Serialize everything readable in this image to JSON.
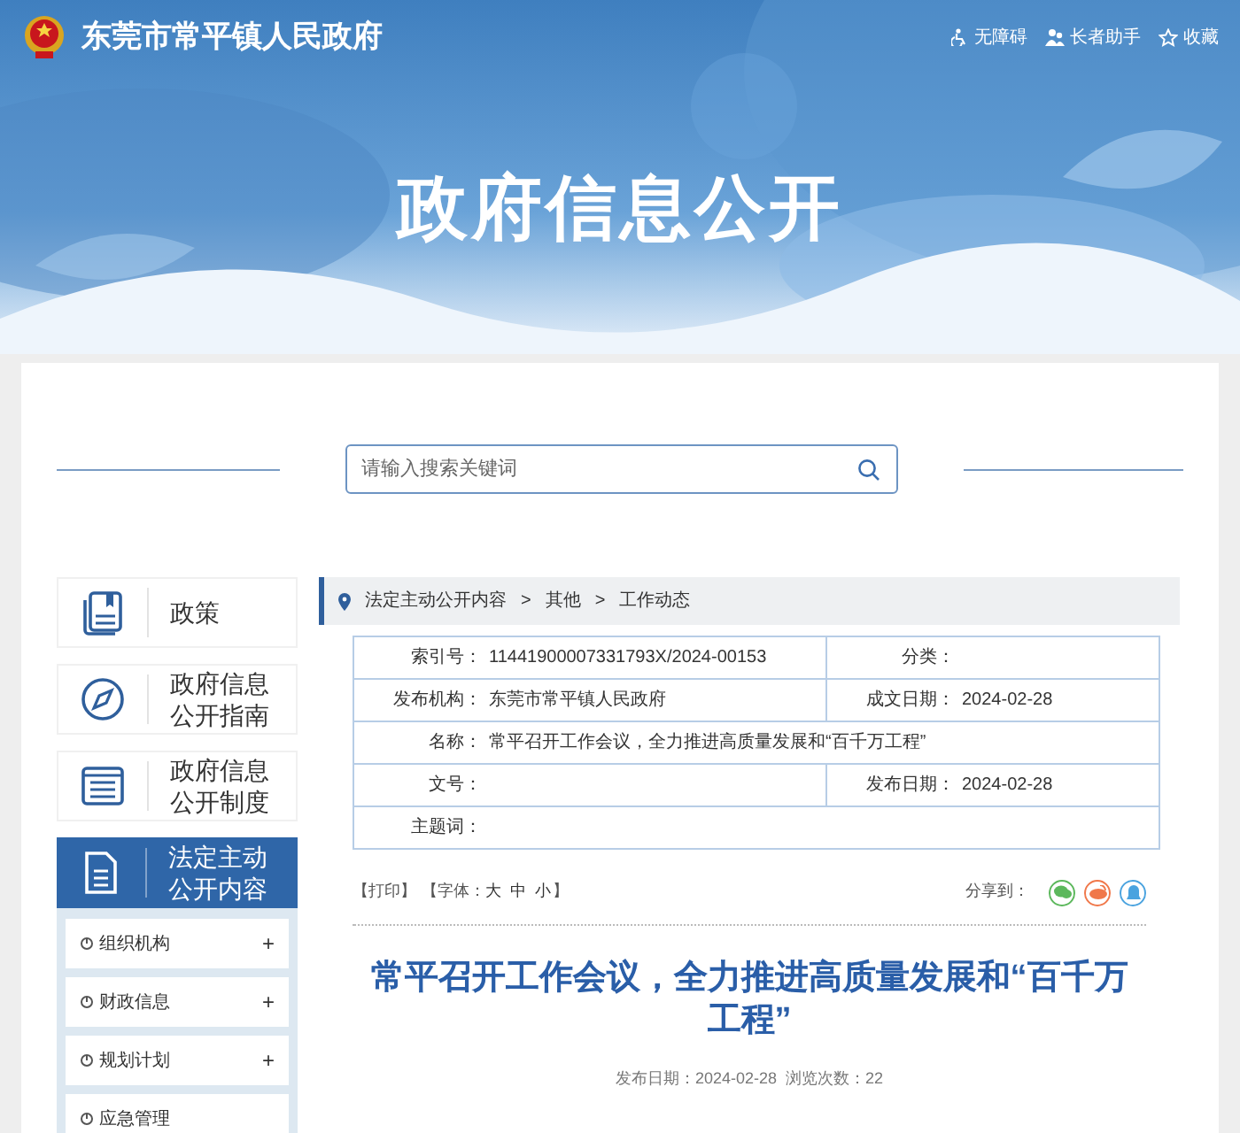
{
  "header": {
    "site_name": "东莞市常平镇人民政府",
    "links": [
      {
        "kind": "accessibility",
        "label": "无障碍"
      },
      {
        "kind": "elder",
        "label": "长者助手"
      },
      {
        "kind": "favorite",
        "label": "收藏"
      }
    ]
  },
  "banner": {
    "title": "政府信息公开"
  },
  "search": {
    "placeholder": "请输入搜索关键词"
  },
  "sidebar": {
    "items": [
      {
        "kind": "book",
        "label": "政策",
        "selected": false
      },
      {
        "kind": "compass",
        "label": "政府信息公开指南",
        "selected": false
      },
      {
        "kind": "list",
        "label": "政府信息公开制度",
        "selected": false
      },
      {
        "kind": "doc",
        "label": "法定主动公开内容",
        "selected": true
      }
    ],
    "sub_items": [
      {
        "label": "组织机构",
        "toggle": "+"
      },
      {
        "label": "财政信息",
        "toggle": "+"
      },
      {
        "label": "规划计划",
        "toggle": "+"
      },
      {
        "label": "应急管理"
      }
    ]
  },
  "breadcrumb": [
    "法定主动公开内容",
    ">",
    "其他",
    ">",
    "工作动态"
  ],
  "info_table": {
    "rows": [
      [
        {
          "label": "索引号：",
          "value": "11441900007331793X/2024-00153"
        },
        {
          "label": "分类："
        }
      ],
      [
        {
          "label": "发布机构：",
          "value": "东莞市常平镇人民政府"
        },
        {
          "label": "成文日期：",
          "value": "2024-02-28"
        }
      ],
      [
        {
          "label": "名称：",
          "value": "常平召开工作会议，全力推进高质量发展和“百千万工程”",
          "colspan": 2
        }
      ],
      [
        {
          "label": "文号："
        },
        {
          "label": "发布日期：",
          "value": "2024-02-28"
        }
      ],
      [
        {
          "label": "主题词：",
          "colspan": 2
        }
      ]
    ]
  },
  "tools": {
    "print": "【打印】",
    "font_open": "【字体：",
    "sizes": [
      "大",
      "中",
      "小"
    ],
    "font_close": "】",
    "share_label": "分享到：",
    "share": [
      {
        "kind": "wechat",
        "color": "#5cb85c"
      },
      {
        "kind": "weibo",
        "color": "#f0784a"
      },
      {
        "kind": "qq",
        "color": "#4aa3df"
      }
    ]
  },
  "article": {
    "title": "常平召开工作会议，全力推进高质量发展和“百千万工程”",
    "meta": "发布日期：2024-02-28  浏览次数：22"
  }
}
